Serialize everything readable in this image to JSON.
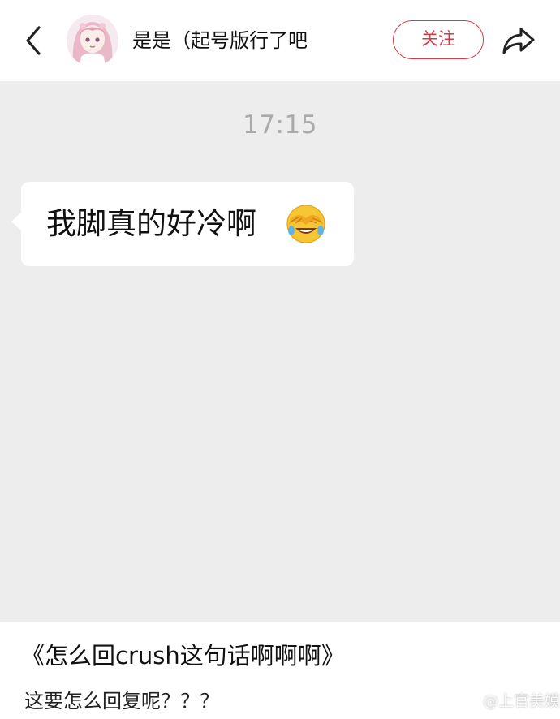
{
  "header": {
    "username": "是是（起号版行了吧",
    "follow_label": "关注",
    "icons": {
      "back": "chevron-left-icon",
      "share": "share-arrow-icon",
      "avatar": "anime-girl-avatar"
    },
    "accent_color": "#d63a4a"
  },
  "chat": {
    "timestamp": "17:15",
    "message": "我脚真的好冷啊",
    "emoji": "face-with-tears-of-joy-covering-eyes"
  },
  "caption": {
    "title": "《怎么回crush这句话啊啊啊》",
    "subtitle": "这要怎么回复呢？？？"
  },
  "watermark": "@上官美嫫"
}
